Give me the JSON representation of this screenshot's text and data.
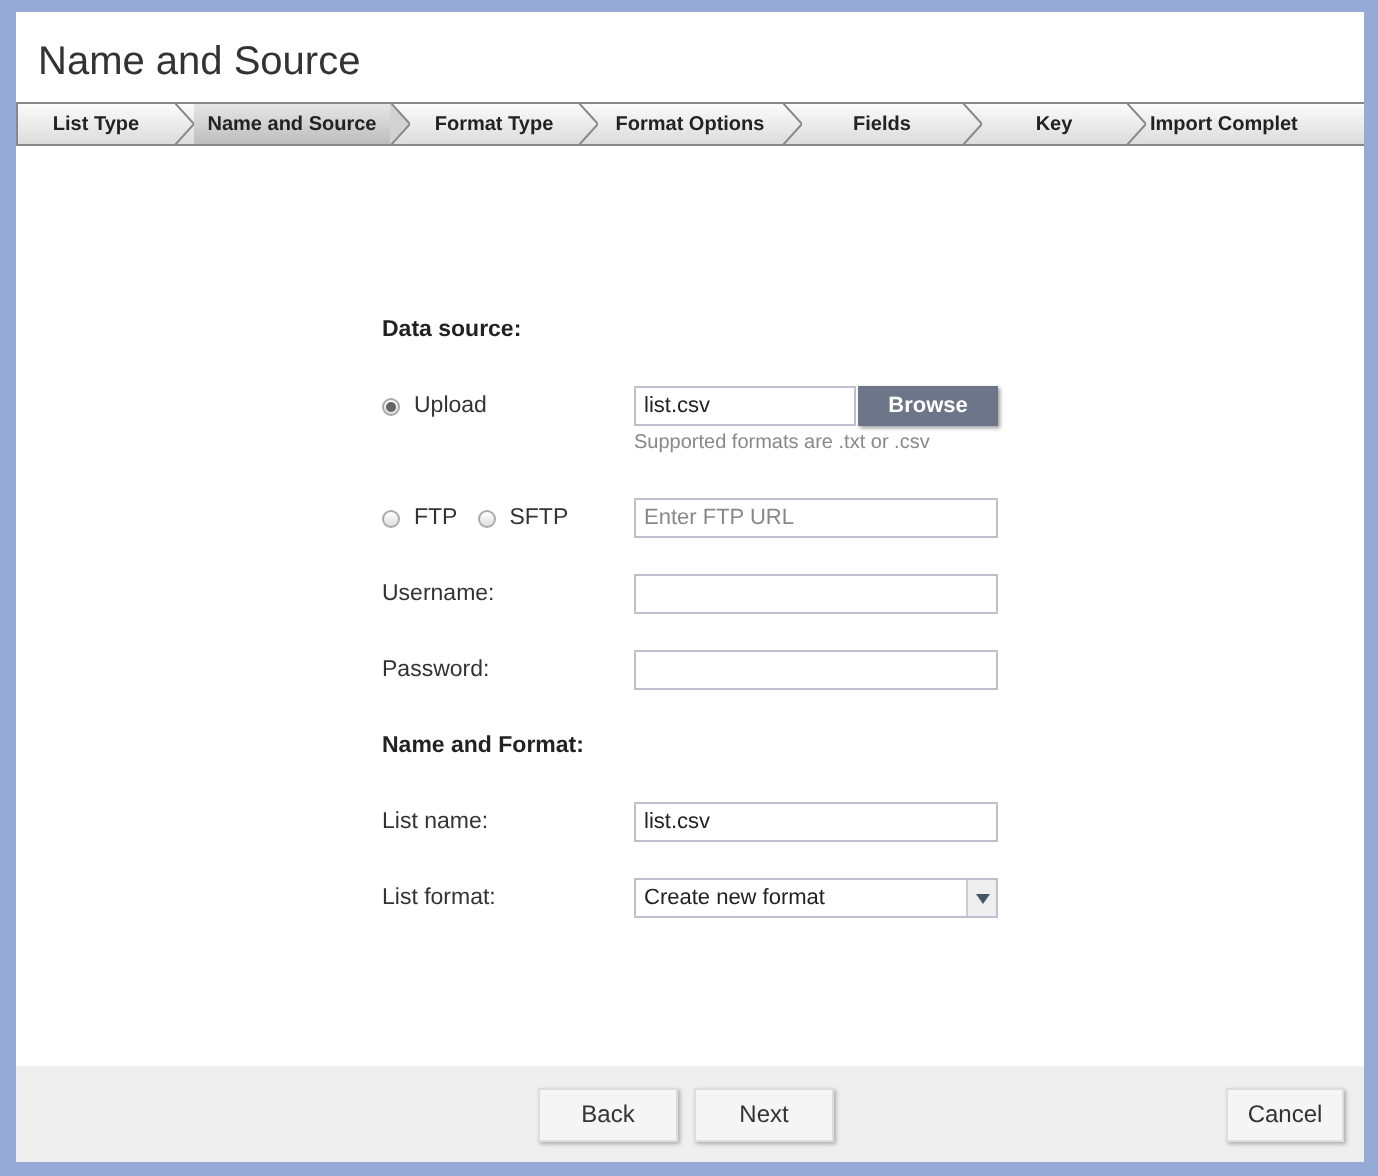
{
  "window": {
    "title": "Name and Source"
  },
  "steps": [
    {
      "label": "List Type",
      "selected": false
    },
    {
      "label": "Name and Source",
      "selected": true
    },
    {
      "label": "Format Type",
      "selected": false
    },
    {
      "label": "Format Options",
      "selected": false
    },
    {
      "label": "Fields",
      "selected": false
    },
    {
      "label": "Key",
      "selected": false
    },
    {
      "label": "Import Complet",
      "selected": false
    }
  ],
  "data_source": {
    "heading": "Data source:",
    "upload": {
      "label": "Upload",
      "selected": true,
      "file_value": "list.csv",
      "browse_button": "Browse",
      "hint": "Supported formats are .txt or .csv"
    },
    "ftp_options": [
      {
        "label": "FTP",
        "selected": false
      },
      {
        "label": "SFTP",
        "selected": false
      }
    ],
    "ftp_url": {
      "placeholder": "Enter FTP URL"
    },
    "username": {
      "label": "Username:"
    },
    "password": {
      "label": "Password:"
    }
  },
  "name_and_format": {
    "heading": "Name and Format:",
    "list_name": {
      "label": "List name:",
      "value": "list.csv"
    },
    "list_format": {
      "label": "List format:",
      "value": "Create new format"
    }
  },
  "buttons": {
    "back": "Back",
    "next": "Next",
    "cancel": "Cancel"
  }
}
